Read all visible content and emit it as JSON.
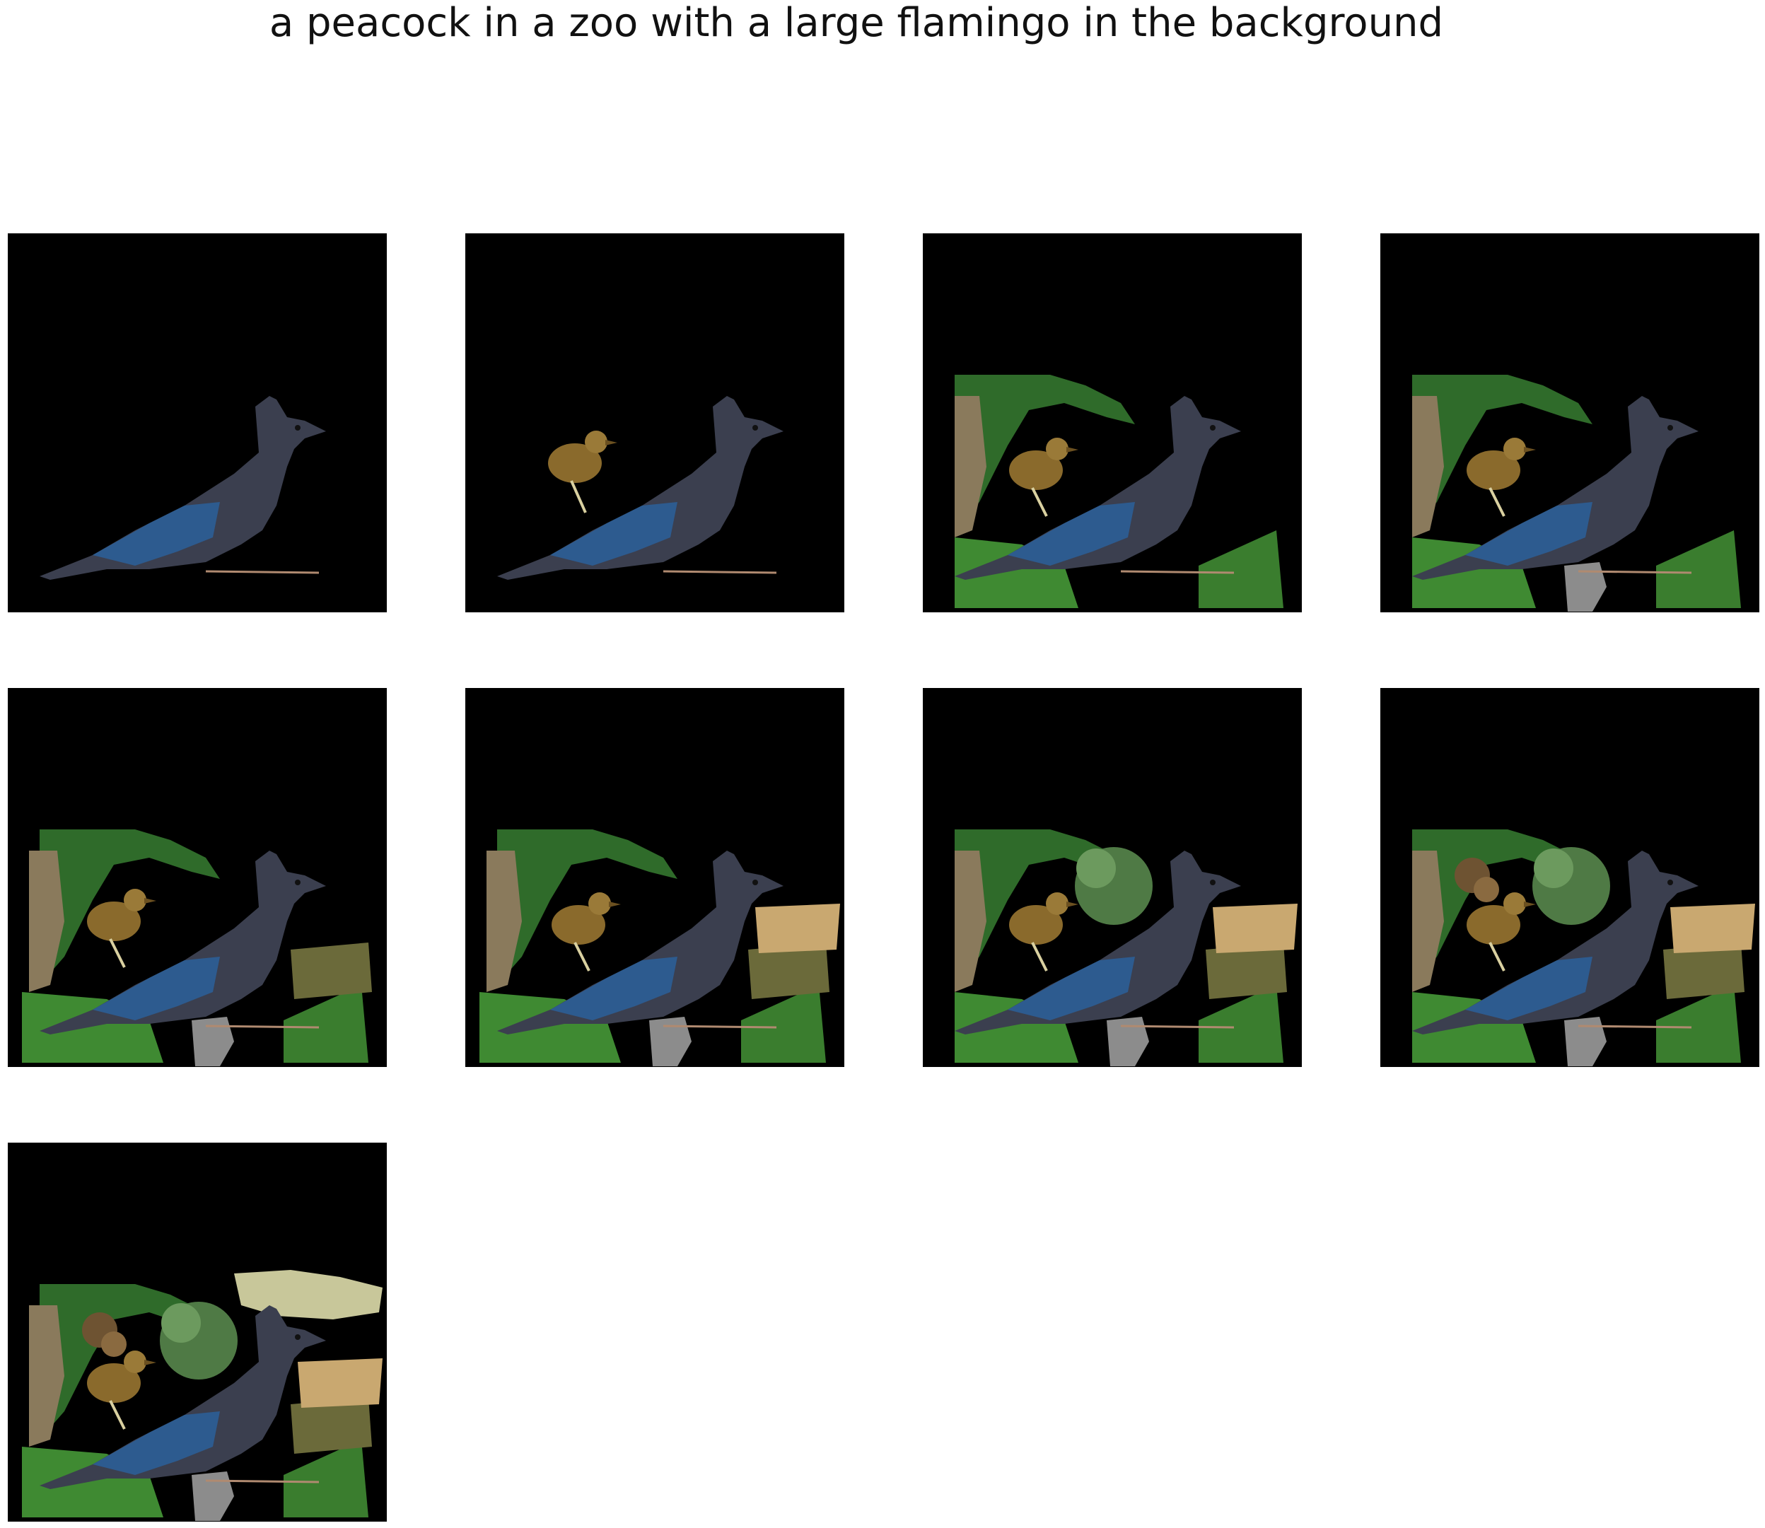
{
  "figure": {
    "title": "a peacock in a zoo with a large flamingo in the background"
  },
  "panels": [
    {
      "index": 1,
      "layers": [
        "jay"
      ]
    },
    {
      "index": 2,
      "layers": [
        "jay",
        "small-bird"
      ]
    },
    {
      "index": 3,
      "layers": [
        "jay",
        "small-bird",
        "leaves"
      ]
    },
    {
      "index": 4,
      "layers": [
        "jay",
        "small-bird",
        "leaves",
        "stump"
      ]
    },
    {
      "index": 5,
      "layers": [
        "jay",
        "small-bird",
        "leaves",
        "stump",
        "shrub"
      ]
    },
    {
      "index": 6,
      "layers": [
        "jay",
        "small-bird",
        "leaves",
        "stump",
        "shrub",
        "sand-patch"
      ]
    },
    {
      "index": 7,
      "layers": [
        "jay",
        "small-bird",
        "leaves",
        "stump",
        "shrub",
        "sand-patch",
        "tree-bush"
      ]
    },
    {
      "index": 8,
      "layers": [
        "jay",
        "small-bird",
        "leaves",
        "stump",
        "shrub",
        "sand-patch",
        "tree-bush",
        "brown-foliage"
      ]
    },
    {
      "index": 9,
      "layers": [
        "jay",
        "small-bird",
        "leaves",
        "stump",
        "shrub",
        "sand-patch",
        "tree-bush",
        "brown-foliage",
        "acacia-tree"
      ]
    }
  ],
  "colors": {
    "panel_background": "#000000",
    "jay_body": "#3b3f4f",
    "jay_wing": "#2d5b8f",
    "small_bird": "#8a6a2c",
    "leaves": "#2f6b2a",
    "sand": "#c9a870"
  }
}
